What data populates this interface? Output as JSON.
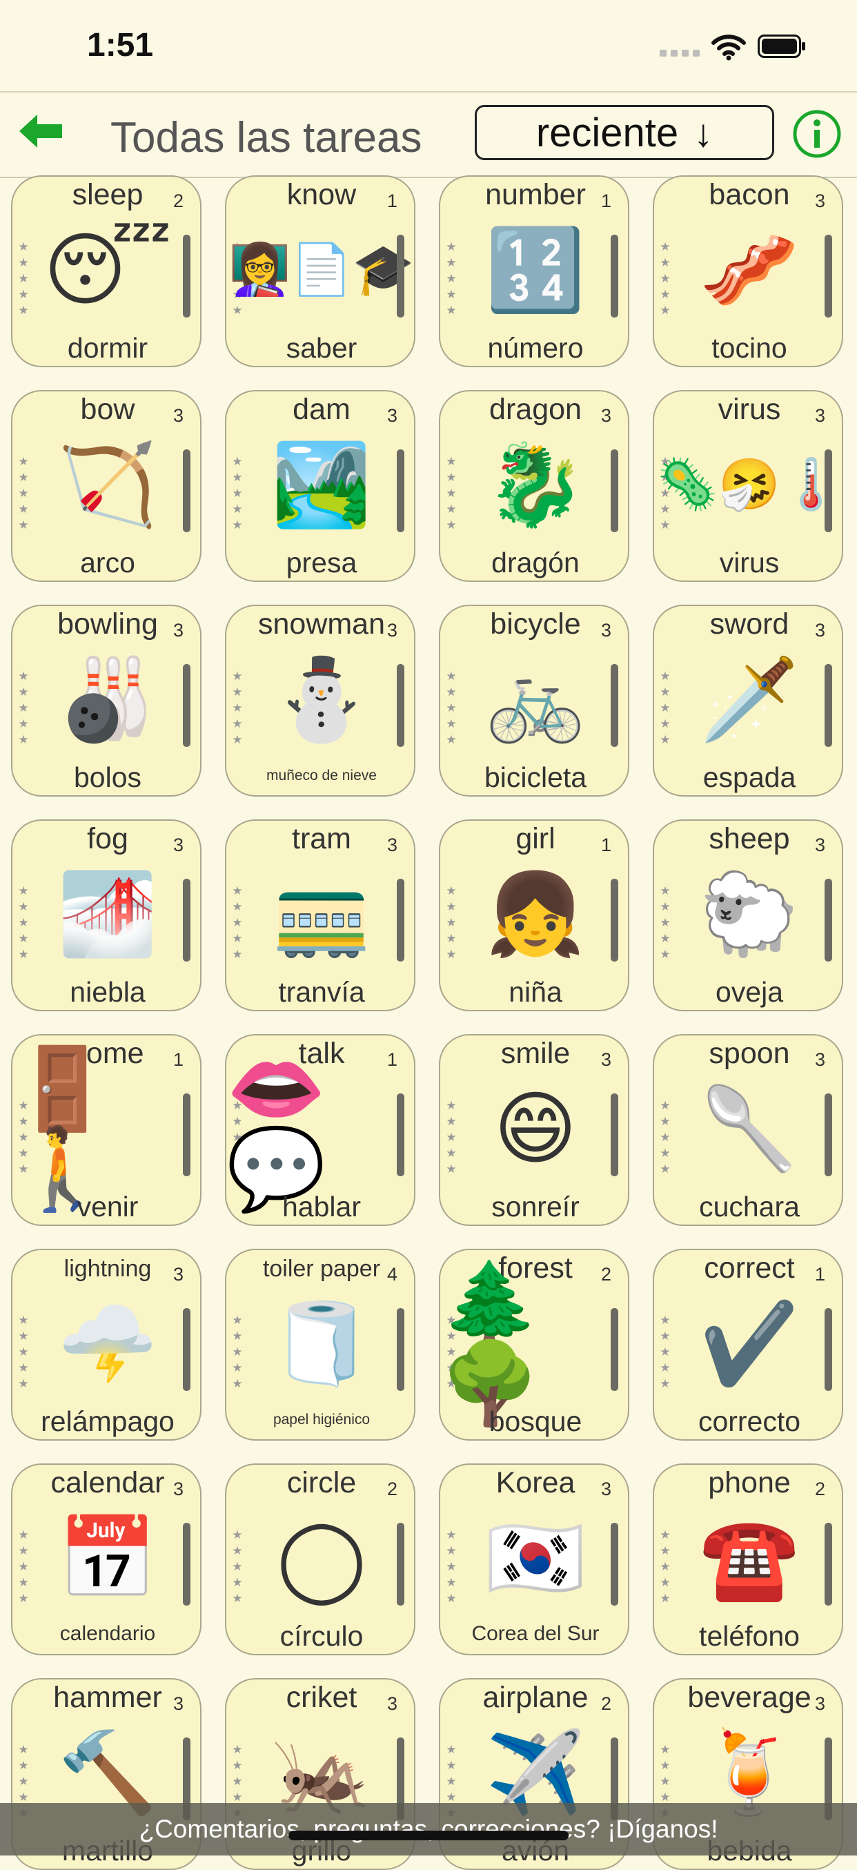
{
  "status_bar": {
    "time": "1:51"
  },
  "nav": {
    "title": "Todas las tareas",
    "sort_label": "reciente",
    "sort_arrow": "↓"
  },
  "footer": {
    "text": "¿Comentarios, preguntas, correcciones? ¡Díganos!"
  },
  "cards": [
    {
      "en": "sleep",
      "es": "dormir",
      "count": "2",
      "icon": "😴"
    },
    {
      "en": "know",
      "es": "saber",
      "count": "1",
      "icon": "👩‍🏫📄🎓"
    },
    {
      "en": "number",
      "es": "número",
      "count": "1",
      "icon": "🔢"
    },
    {
      "en": "bacon",
      "es": "tocino",
      "count": "3",
      "icon": "🥓"
    },
    {
      "en": "bow",
      "es": "arco",
      "count": "3",
      "icon": "🏹"
    },
    {
      "en": "dam",
      "es": "presa",
      "count": "3",
      "icon": "🏞️"
    },
    {
      "en": "dragon",
      "es": "dragón",
      "count": "3",
      "icon": "🐉"
    },
    {
      "en": "virus",
      "es": "virus",
      "count": "3",
      "icon": "🦠🤧🌡️"
    },
    {
      "en": "bowling",
      "es": "bolos",
      "count": "3",
      "icon": "🎳"
    },
    {
      "en": "snowman",
      "es": "muñeco de nieve",
      "count": "3",
      "icon": "⛄"
    },
    {
      "en": "bicycle",
      "es": "bicicleta",
      "count": "3",
      "icon": "🚲"
    },
    {
      "en": "sword",
      "es": "espada",
      "count": "3",
      "icon": "🗡️"
    },
    {
      "en": "fog",
      "es": "niebla",
      "count": "3",
      "icon": "🌁"
    },
    {
      "en": "tram",
      "es": "tranvía",
      "count": "3",
      "icon": "🚃"
    },
    {
      "en": "girl",
      "es": "niña",
      "count": "1",
      "icon": "👧"
    },
    {
      "en": "sheep",
      "es": "oveja",
      "count": "3",
      "icon": "🐑"
    },
    {
      "en": "come",
      "es": "venir",
      "count": "1",
      "icon": "🚪🚶"
    },
    {
      "en": "talk",
      "es": "hablar",
      "count": "1",
      "icon": "👄💬"
    },
    {
      "en": "smile",
      "es": "sonreír",
      "count": "3",
      "icon": "😄"
    },
    {
      "en": "spoon",
      "es": "cuchara",
      "count": "3",
      "icon": "🥄"
    },
    {
      "en": "lightning",
      "es": "relámpago",
      "count": "3",
      "icon": "🌩️"
    },
    {
      "en": "toiler paper",
      "es": "papel higiénico",
      "count": "4",
      "icon": "🧻"
    },
    {
      "en": "forest",
      "es": "bosque",
      "count": "2",
      "icon": "🌲🌳"
    },
    {
      "en": "correct",
      "es": "correcto",
      "count": "1",
      "icon": "✔️"
    },
    {
      "en": "calendar",
      "es": "calendario",
      "count": "3",
      "icon": "📅"
    },
    {
      "en": "circle",
      "es": "círculo",
      "count": "2",
      "icon": "◯"
    },
    {
      "en": "Korea",
      "es": "Corea del Sur",
      "count": "3",
      "icon": "🇰🇷"
    },
    {
      "en": "phone",
      "es": "teléfono",
      "count": "2",
      "icon": "☎️"
    },
    {
      "en": "hammer",
      "es": "martillo",
      "count": "3",
      "icon": "🔨"
    },
    {
      "en": "criket",
      "es": "grillo",
      "count": "3",
      "icon": "🦗"
    },
    {
      "en": "airplane",
      "es": "avión",
      "count": "2",
      "icon": "✈️"
    },
    {
      "en": "beverage",
      "es": "bebida",
      "count": "3",
      "icon": "🍹"
    }
  ]
}
